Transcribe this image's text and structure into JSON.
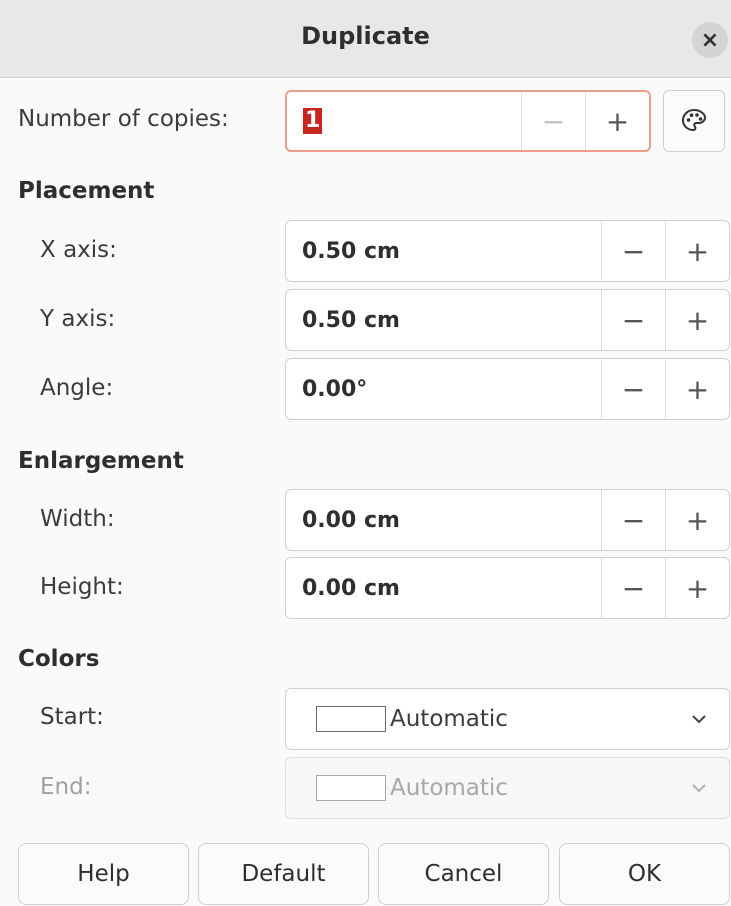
{
  "dialog": {
    "title": "Duplicate",
    "close_glyph": "×"
  },
  "copies": {
    "label": "Number of copies:",
    "value": "1",
    "minus": "−",
    "plus": "+",
    "palette_icon": "palette-icon"
  },
  "placement": {
    "heading": "Placement",
    "x_axis": {
      "label": "X axis:",
      "value": "0.50 cm"
    },
    "y_axis": {
      "label": "Y axis:",
      "value": "0.50 cm"
    },
    "angle": {
      "label": "Angle:",
      "value": "0.00°"
    }
  },
  "enlargement": {
    "heading": "Enlargement",
    "width": {
      "label": "Width:",
      "value": "0.00 cm"
    },
    "height": {
      "label": "Height:",
      "value": "0.00 cm"
    }
  },
  "colors": {
    "heading": "Colors",
    "start": {
      "label": "Start:",
      "value": "Automatic"
    },
    "end": {
      "label": "End:",
      "value": "Automatic",
      "disabled": true
    }
  },
  "spin": {
    "minus": "−",
    "plus": "+"
  },
  "buttons": {
    "help": "Help",
    "default": "Default",
    "cancel": "Cancel",
    "ok": "OK"
  },
  "theme": {
    "focus_border": "#e8a08c",
    "selection": "#c7251d",
    "titlebar": "#e8e8e8"
  }
}
